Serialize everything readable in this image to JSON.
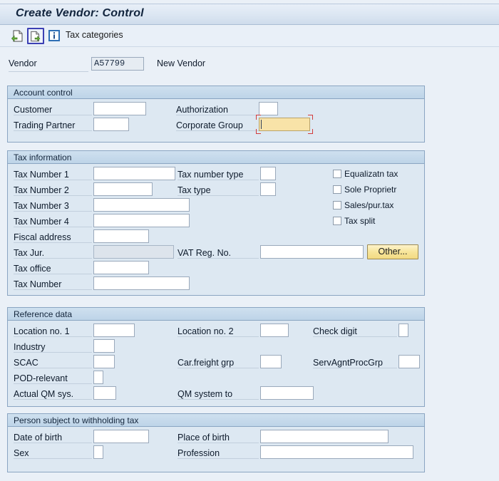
{
  "window": {
    "title": "Create Vendor: Control"
  },
  "toolbar": {
    "back_icon": "page-back-arrow-icon",
    "forward_icon": "page-forward-arrow-icon",
    "info_icon": "information-icon",
    "tax_categories_label": "Tax categories",
    "selected_button": "forward"
  },
  "header": {
    "vendor_label": "Vendor",
    "vendor_value": "A57799",
    "vendor_status": "New Vendor"
  },
  "sections": {
    "account_control": {
      "title": "Account control",
      "fields": {
        "customer": {
          "label": "Customer",
          "value": ""
        },
        "trading_partner": {
          "label": "Trading Partner",
          "value": ""
        },
        "authorization": {
          "label": "Authorization",
          "value": ""
        },
        "corporate_group": {
          "label": "Corporate Group",
          "value": "",
          "focused": true
        }
      }
    },
    "tax_information": {
      "title": "Tax information",
      "fields": {
        "tax_number_1": {
          "label": "Tax Number 1",
          "value": ""
        },
        "tax_number_2": {
          "label": "Tax Number 2",
          "value": ""
        },
        "tax_number_3": {
          "label": "Tax Number 3",
          "value": ""
        },
        "tax_number_4": {
          "label": "Tax Number 4",
          "value": ""
        },
        "fiscal_address": {
          "label": "Fiscal address",
          "value": ""
        },
        "tax_jur": {
          "label": "Tax Jur.",
          "value": "",
          "disabled": true
        },
        "tax_office": {
          "label": "Tax office",
          "value": ""
        },
        "tax_number": {
          "label": "Tax Number",
          "value": ""
        },
        "tax_number_type": {
          "label": "Tax number type",
          "value": ""
        },
        "tax_type": {
          "label": "Tax type",
          "value": ""
        },
        "vat_reg_no": {
          "label": "VAT Reg. No.",
          "value": ""
        }
      },
      "other_button": "Other...",
      "checkboxes": [
        {
          "label": "Equalizatn tax",
          "checked": false
        },
        {
          "label": "Sole Proprietr",
          "checked": false
        },
        {
          "label": "Sales/pur.tax",
          "checked": false
        },
        {
          "label": "Tax split",
          "checked": false
        }
      ]
    },
    "reference_data": {
      "title": "Reference data",
      "fields": {
        "location_no_1": {
          "label": "Location no. 1",
          "value": ""
        },
        "industry": {
          "label": "Industry",
          "value": ""
        },
        "scac": {
          "label": "SCAC",
          "value": ""
        },
        "pod_relevant": {
          "label": "POD-relevant",
          "value": ""
        },
        "actual_qm_sys": {
          "label": "Actual QM sys.",
          "value": ""
        },
        "location_no_2": {
          "label": "Location no. 2",
          "value": ""
        },
        "car_freight_grp": {
          "label": "Car.freight grp",
          "value": ""
        },
        "qm_system_to": {
          "label": "QM system to",
          "value": ""
        },
        "check_digit": {
          "label": "Check digit",
          "value": ""
        },
        "serv_agnt_proc_grp": {
          "label": "ServAgntProcGrp",
          "value": ""
        }
      }
    },
    "withholding": {
      "title": "Person subject to withholding tax",
      "fields": {
        "date_of_birth": {
          "label": "Date of birth",
          "value": ""
        },
        "sex": {
          "label": "Sex",
          "value": ""
        },
        "place_of_birth": {
          "label": "Place of birth",
          "value": ""
        },
        "profession": {
          "label": "Profession",
          "value": ""
        }
      }
    }
  },
  "colors": {
    "page_background": "#eaf0f7",
    "panel_background": "#dde8f2",
    "panel_border": "#8aa5c2",
    "focus_field": "#f8e3a8",
    "focus_marker": "#d23b3b",
    "selection_border": "#3c40b4",
    "button_yellow": "#f7e59a"
  }
}
